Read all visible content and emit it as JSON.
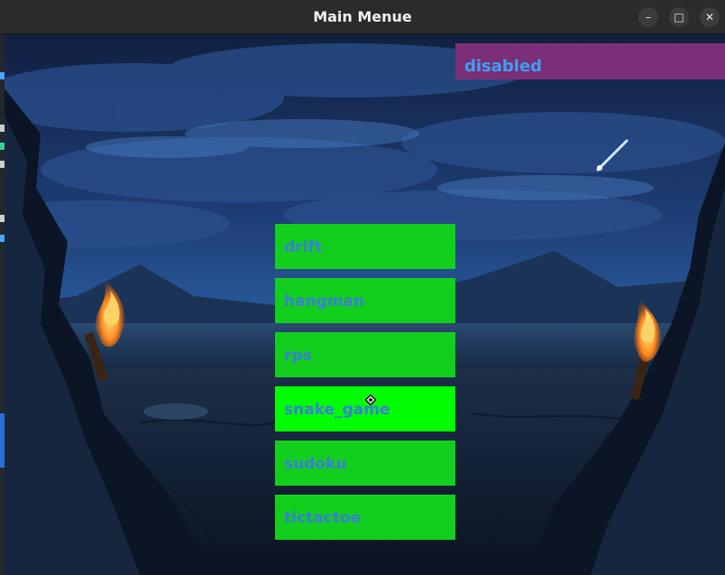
{
  "window": {
    "title": "Main Menue",
    "controls": {
      "minimize": "–",
      "maximize": "□",
      "close": "✕"
    }
  },
  "status": {
    "label": "disabled"
  },
  "menu": {
    "items": [
      {
        "label": "drift"
      },
      {
        "label": "hangman"
      },
      {
        "label": "rps"
      },
      {
        "label": "snake_game"
      },
      {
        "label": "sudoku"
      },
      {
        "label": "tictactoe"
      }
    ],
    "hovered_index": 3
  },
  "colors": {
    "button": "#12cf1e",
    "button_hover": "#00fd00",
    "button_text": "#3a7fd6",
    "banner_bg": "#7a2f78",
    "banner_text": "#3ea0f0"
  },
  "background": {
    "scene": "night lake between two rocky cliffs with burning torches and a shooting star"
  }
}
